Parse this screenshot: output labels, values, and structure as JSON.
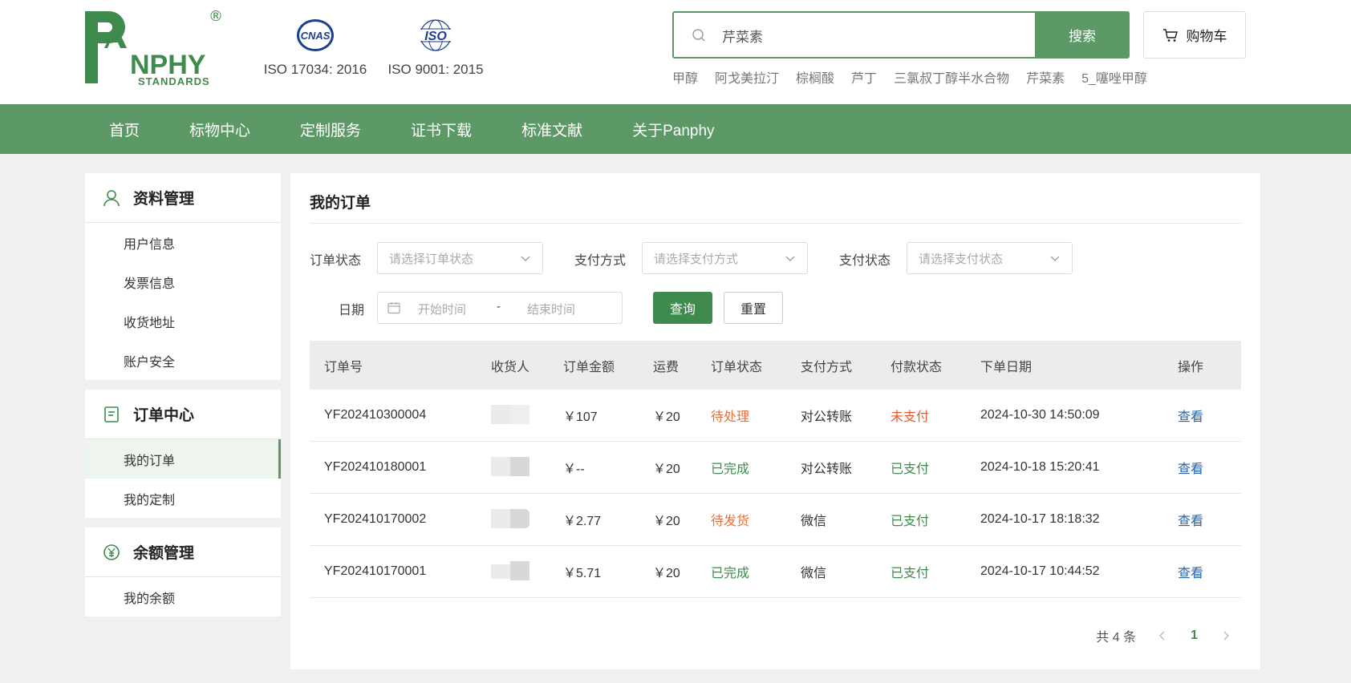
{
  "brand": {
    "logo_name": "PANPHY",
    "logo_sub": "STANDARDS",
    "registered": "®",
    "colors": {
      "primary": "#5d9966",
      "dark_green": "#3f8a4d",
      "link": "#2a64a8",
      "orange": "#e8703a",
      "red": "#e35b2e"
    }
  },
  "certs": [
    {
      "badge_text": "CNAS",
      "label": "ISO 17034: 2016",
      "icon": "cnas-logo-icon"
    },
    {
      "badge_text": "ISO",
      "label": "ISO 9001: 2015",
      "icon": "iso-logo-icon"
    }
  ],
  "search": {
    "value": "芹菜素",
    "button": "搜索",
    "hot_words": [
      "甲醇",
      "阿戈美拉汀",
      "棕榈酸",
      "芦丁",
      "三氯叔丁醇半水合物",
      "芹菜素",
      "5_噻唑甲醇"
    ]
  },
  "cart": {
    "label": "购物车",
    "icon": "cart-icon"
  },
  "nav": [
    "首页",
    "标物中心",
    "定制服务",
    "证书下载",
    "标准文献",
    "关于Panphy"
  ],
  "sidebar": {
    "groups": [
      {
        "title": "资料管理",
        "icon": "user-icon",
        "items": [
          "用户信息",
          "发票信息",
          "收货地址",
          "账户安全"
        ]
      },
      {
        "title": "订单中心",
        "icon": "document-icon",
        "items": [
          "我的订单",
          "我的定制"
        ],
        "active": "我的订单"
      },
      {
        "title": "余额管理",
        "icon": "yen-icon",
        "items": [
          "我的余额"
        ]
      }
    ]
  },
  "main": {
    "title": "我的订单",
    "filters": {
      "order_status_label": "订单状态",
      "order_status_placeholder": "请选择订单状态",
      "pay_method_label": "支付方式",
      "pay_method_placeholder": "请选择支付方式",
      "pay_status_label": "支付状态",
      "pay_status_placeholder": "请选择支付状态",
      "date_label": "日期",
      "date_start": "开始时间",
      "date_sep": "-",
      "date_end": "结束时间",
      "query": "查询",
      "reset": "重置"
    },
    "table": {
      "headers": [
        "订单号",
        "收货人",
        "订单金额",
        "运费",
        "订单状态",
        "支付方式",
        "付款状态",
        "下单日期",
        "操作"
      ],
      "rows": [
        {
          "no": "YF202410300004",
          "amount": "￥107",
          "fee": "￥20",
          "status": "待处理",
          "status_color": "orange",
          "pay": "对公转账",
          "pay_status": "未支付",
          "pay_status_color": "red",
          "date": "2024-10-30 14:50:09",
          "op": "查看"
        },
        {
          "no": "YF202410180001",
          "amount": "￥--",
          "fee": "￥20",
          "status": "已完成",
          "status_color": "green",
          "pay": "对公转账",
          "pay_status": "已支付",
          "pay_status_color": "green",
          "date": "2024-10-18 15:20:41",
          "op": "查看"
        },
        {
          "no": "YF202410170002",
          "amount": "￥2.77",
          "fee": "￥20",
          "status": "待发货",
          "status_color": "orange",
          "pay": "微信",
          "pay_status": "已支付",
          "pay_status_color": "green",
          "date": "2024-10-17 18:18:32",
          "op": "查看"
        },
        {
          "no": "YF202410170001",
          "amount": "￥5.71",
          "fee": "￥20",
          "status": "已完成",
          "status_color": "green",
          "pay": "微信",
          "pay_status": "已支付",
          "pay_status_color": "green",
          "date": "2024-10-17 10:44:52",
          "op": "查看"
        }
      ]
    },
    "pagination": {
      "total": "共 4 条",
      "current": "1"
    }
  }
}
